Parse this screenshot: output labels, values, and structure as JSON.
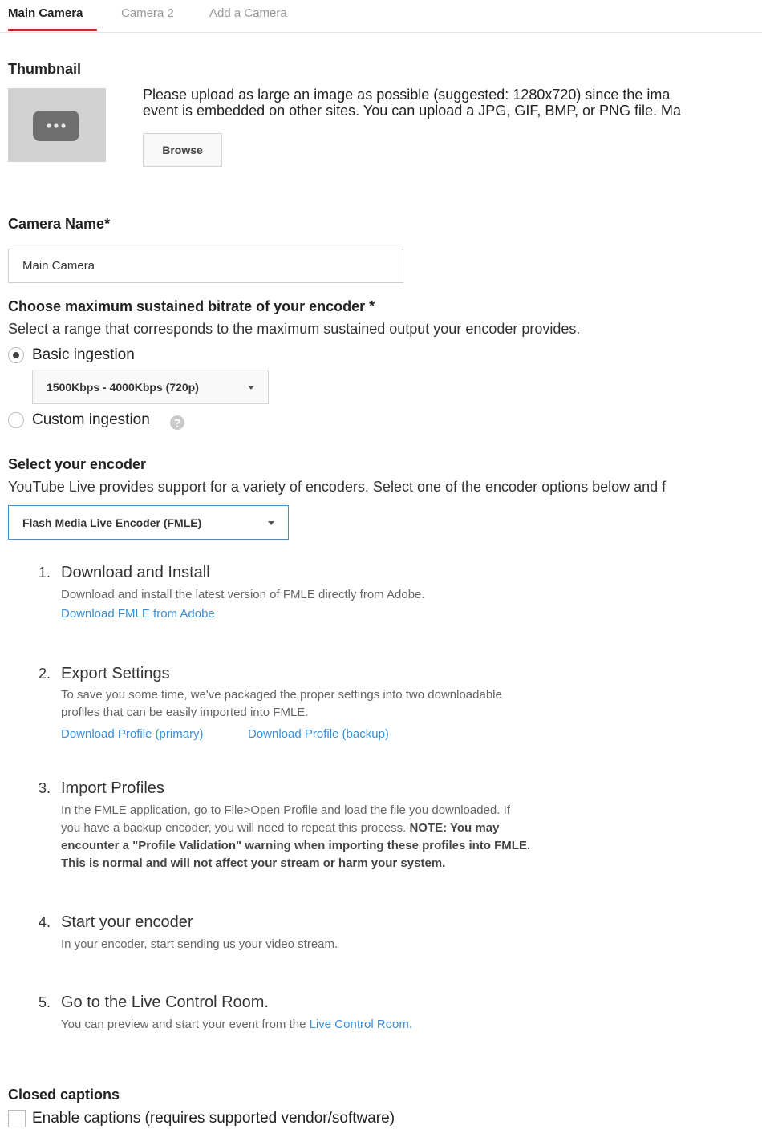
{
  "tabs": [
    {
      "label": "Main Camera",
      "active": true
    },
    {
      "label": "Camera 2",
      "active": false
    },
    {
      "label": "Add a Camera",
      "active": false
    }
  ],
  "accent_color": "#c4302b",
  "link_color": "#3b8ed6",
  "thumbnail": {
    "title": "Thumbnail",
    "icon": "ellipsis-icon",
    "instructions_line1": "Please upload as large an image as possible (suggested: 1280x720) since the ima",
    "instructions_line2": "event is embedded on other sites. You can upload a JPG, GIF, BMP, or PNG file. Ma",
    "browse_label": "Browse"
  },
  "camera_name": {
    "label": "Camera Name*",
    "value": "Main Camera"
  },
  "bitrate": {
    "title": "Choose maximum sustained bitrate of your encoder *",
    "description": "Select a range that corresponds to the maximum sustained output your encoder provides.",
    "basic_label": "Basic ingestion",
    "basic_selected": true,
    "basic_dropdown_value": "1500Kbps - 4000Kbps (720p)",
    "custom_label": "Custom ingestion",
    "custom_selected": false
  },
  "encoder": {
    "title": "Select your encoder",
    "description": "YouTube Live provides support for a variety of encoders. Select one of the encoder options below and f",
    "dropdown_value": "Flash Media Live Encoder (FMLE)"
  },
  "steps": [
    {
      "number": "1.",
      "title": "Download and Install",
      "desc_lines": [
        "Download and install the latest version of FMLE directly from Adobe."
      ],
      "links": [
        "Download FMLE from Adobe"
      ]
    },
    {
      "number": "2.",
      "title": "Export Settings",
      "desc_lines": [
        "To save you some time, we've packaged the proper settings into two downloadable",
        "profiles that can be easily imported into FMLE."
      ],
      "links": [
        "Download Profile (primary)",
        "Download Profile (backup)"
      ]
    },
    {
      "number": "3.",
      "title": "Import Profiles",
      "desc_line1": "In the FMLE application, go to File>Open Profile and load the file you downloaded. If",
      "desc_line2_plain": "you have a backup encoder, you will need to repeat this process. ",
      "desc_line2_bold": "NOTE: You may",
      "desc_line3_bold": "encounter a \"Profile Validation\" warning when importing these profiles into FMLE.",
      "desc_line4_bold": "This is normal and will not affect your stream or harm your system."
    },
    {
      "number": "4.",
      "title": "Start your encoder",
      "desc_lines": [
        "In your encoder, start sending us your video stream."
      ]
    },
    {
      "number": "5.",
      "title": "Go to the Live Control Room.",
      "desc_prefix": "You can preview and start your event from the ",
      "desc_link": "Live Control Room."
    }
  ],
  "captions": {
    "title": "Closed captions",
    "checkbox_label": "Enable captions (requires supported vendor/software)",
    "checked": false
  }
}
